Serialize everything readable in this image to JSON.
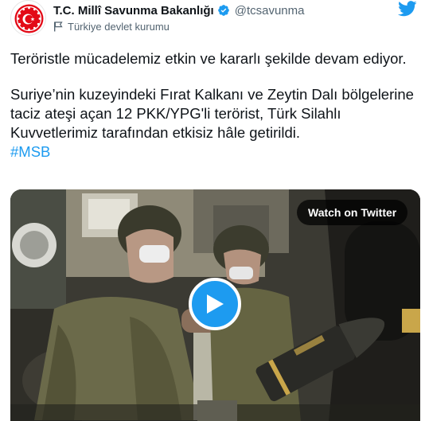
{
  "account": {
    "display_name": "T.C. Millî Savunma Bakanlığı",
    "handle": "@tcsavunma",
    "label": "Türkiye devlet kurumu",
    "verified": true
  },
  "tweet": {
    "paragraph1": "Teröristle mücadelemiz etkin ve kararlı şekilde devam ediyor.",
    "paragraph2": "Suriye’nin kuzeyindeki Fırat Kalkanı ve Zeytin Dalı bölgelerine taciz ateşi açan 12 PKK/YPG'li terörist, Türk Silahlı Kuvvetlerimiz tarafından etkisiz hâle getirildi.",
    "hashtag": "#MSB"
  },
  "media": {
    "type": "video",
    "watch_label": "Watch on Twitter"
  },
  "icons": {
    "twitter": "twitter-bird-icon",
    "verified": "verified-badge-icon",
    "label": "flag-icon",
    "play": "play-icon"
  },
  "colors": {
    "accent": "#1d9bf0",
    "text": "#0f1419",
    "secondary_text": "#536471",
    "emblem_red": "#e30a17"
  }
}
